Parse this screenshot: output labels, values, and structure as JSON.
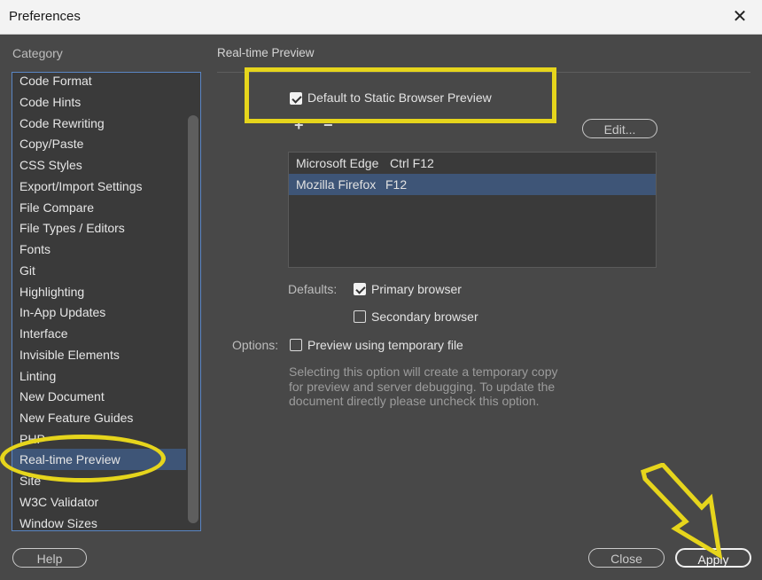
{
  "window": {
    "title": "Preferences"
  },
  "category": {
    "label": "Category",
    "items": [
      "Code Format",
      "Code Hints",
      "Code Rewriting",
      "Copy/Paste",
      "CSS Styles",
      "Export/Import Settings",
      "File Compare",
      "File Types / Editors",
      "Fonts",
      "Git",
      "Highlighting",
      "In-App Updates",
      "Interface",
      "Invisible Elements",
      "Linting",
      "New Document",
      "New Feature Guides",
      "PHP",
      "Real-time Preview",
      "Site",
      "W3C Validator",
      "Window Sizes"
    ],
    "selected": "Real-time Preview"
  },
  "panel": {
    "title": "Real-time Preview",
    "static_preview": {
      "label": "Default to Static Browser Preview",
      "checked": true
    },
    "add_symbol": "+",
    "remove_symbol": "−",
    "edit_label": "Edit...",
    "browsers": [
      {
        "name": "Microsoft Edge",
        "shortcut": "Ctrl F12",
        "selected": false
      },
      {
        "name": "Mozilla Firefox",
        "shortcut": "F12",
        "selected": true
      }
    ],
    "defaults_label": "Defaults:",
    "primary": {
      "label": "Primary browser",
      "checked": true
    },
    "secondary": {
      "label": "Secondary browser",
      "checked": false
    },
    "options_label": "Options:",
    "temp_file": {
      "label": "Preview using temporary file",
      "checked": false
    },
    "description": "Selecting this option will create a temporary copy for preview and server debugging. To update the document directly please uncheck this option."
  },
  "footer": {
    "help_label": "Help",
    "close_label": "Close",
    "apply_label": "Apply"
  },
  "colors": {
    "highlight": "#e6d51c",
    "selection": "#3e5577",
    "background": "#484848"
  },
  "icons": {
    "close": "close-icon",
    "check": "checkmark-icon",
    "arrow": "arrow-icon"
  }
}
